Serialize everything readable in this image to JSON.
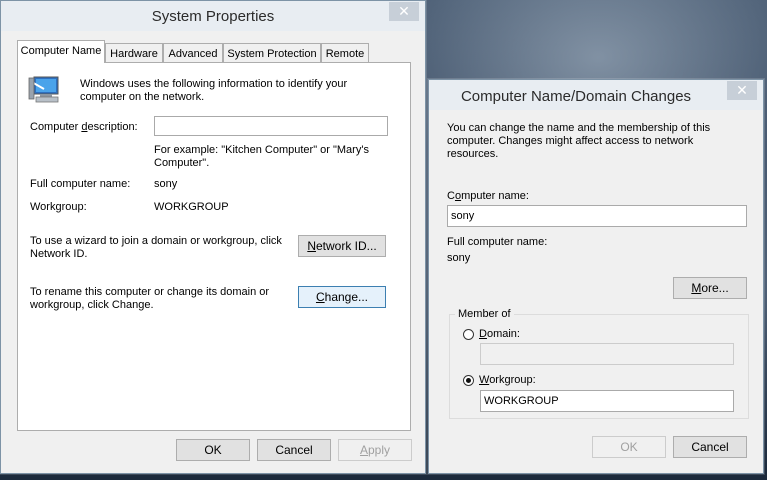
{
  "system_properties": {
    "title": "System Properties",
    "close": "✕",
    "tabs": [
      {
        "label": "Computer Name",
        "active": true
      },
      {
        "label": "Hardware",
        "active": false
      },
      {
        "label": "Advanced",
        "active": false
      },
      {
        "label": "System Protection",
        "active": false
      },
      {
        "label": "Remote",
        "active": false
      }
    ],
    "intro": "Windows uses the following information to identify your computer on the network.",
    "description_label": "Computer description:",
    "description_value": "",
    "example": "For example: \"Kitchen Computer\" or \"Mary's Computer\".",
    "full_name_label": "Full computer name:",
    "full_name_value": "sony",
    "workgroup_label": "Workgroup:",
    "workgroup_value": "WORKGROUP",
    "network_id_text": "To use a wizard to join a domain or workgroup, click Network ID.",
    "network_id_button": "Network ID...",
    "rename_text": "To rename this computer or change its domain or workgroup, click Change.",
    "change_button": "Change...",
    "ok": "OK",
    "cancel": "Cancel",
    "apply": "Apply"
  },
  "domain_changes": {
    "title": "Computer Name/Domain Changes",
    "close": "✕",
    "intro": "You can change the name and the membership of this computer. Changes might affect access to network resources.",
    "computer_name_label": "Computer name:",
    "computer_name_value": "sony",
    "full_name_label": "Full computer name:",
    "full_name_value": "sony",
    "more_button": "More...",
    "member_of": "Member of",
    "domain_label": "Domain:",
    "domain_value": "",
    "domain_selected": false,
    "workgroup_label": "Workgroup:",
    "workgroup_value": "WORKGROUP",
    "workgroup_selected": true,
    "ok": "OK",
    "cancel": "Cancel"
  }
}
